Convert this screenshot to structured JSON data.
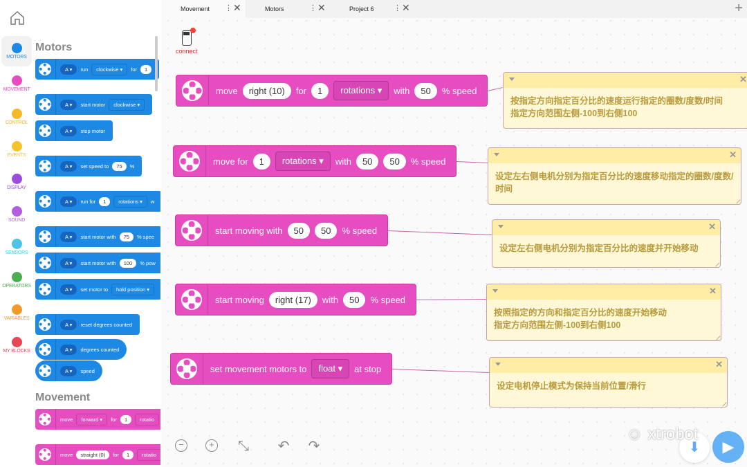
{
  "sidebar": {
    "categories": [
      {
        "label": "MOTORS",
        "color": "#1e88e5",
        "selected": true
      },
      {
        "label": "MOVEMENT",
        "color": "#e64dc1"
      },
      {
        "label": "CONTROL",
        "color": "#f5b72c"
      },
      {
        "label": "EVENTS",
        "color": "#f5c32c"
      },
      {
        "label": "DISPLAY",
        "color": "#9c4ddf"
      },
      {
        "label": "SOUND",
        "color": "#b45ee0"
      },
      {
        "label": "SENSORS",
        "color": "#4fc3e8"
      },
      {
        "label": "OPERATORS",
        "color": "#4caf50"
      },
      {
        "label": "VARIABLES",
        "color": "#f39a2b"
      },
      {
        "label": "MY BLOCKS",
        "color": "#e84855"
      }
    ]
  },
  "palette": {
    "motors_heading": "Motors",
    "movement_heading": "Movement",
    "blocks": [
      {
        "kind": "motor",
        "parts": [
          [
            "dd",
            "A ▾"
          ],
          [
            "t",
            "run"
          ],
          [
            "ddr",
            "clockwise ▾"
          ],
          [
            "t",
            "for"
          ],
          [
            "fld",
            "1"
          ]
        ]
      },
      {
        "kind": "motor",
        "parts": [
          [
            "dd",
            "A ▾"
          ],
          [
            "t",
            "start motor"
          ],
          [
            "ddr",
            "clockwise ▾"
          ]
        ]
      },
      {
        "kind": "motor",
        "parts": [
          [
            "dd",
            "A ▾"
          ],
          [
            "t",
            "stop motor"
          ]
        ]
      },
      {
        "kind": "motor",
        "parts": [
          [
            "dd",
            "A ▾"
          ],
          [
            "t",
            "set speed to"
          ],
          [
            "fld",
            "75"
          ],
          [
            "t",
            "%"
          ]
        ]
      },
      {
        "kind": "motor",
        "parts": [
          [
            "dd",
            "A ▾"
          ],
          [
            "t",
            "run for"
          ],
          [
            "fld",
            "1"
          ],
          [
            "ddr",
            "rotations ▾"
          ],
          [
            "t",
            "w"
          ]
        ]
      },
      {
        "kind": "motor",
        "parts": [
          [
            "dd",
            "A ▾"
          ],
          [
            "t",
            "start motor with"
          ],
          [
            "fld",
            "75"
          ],
          [
            "t",
            "% spee"
          ]
        ]
      },
      {
        "kind": "motor",
        "parts": [
          [
            "dd",
            "A ▾"
          ],
          [
            "t",
            "start motor with"
          ],
          [
            "fld",
            "100"
          ],
          [
            "t",
            "% pow"
          ]
        ]
      },
      {
        "kind": "motor",
        "parts": [
          [
            "dd",
            "A ▾"
          ],
          [
            "t",
            "set motor to"
          ],
          [
            "ddr",
            "hold position ▾"
          ]
        ]
      },
      {
        "kind": "motor",
        "parts": [
          [
            "dd",
            "A ▾"
          ],
          [
            "t",
            "reset degrees counted"
          ]
        ]
      },
      {
        "kind": "reporter",
        "parts": [
          [
            "dd",
            "A ▾"
          ],
          [
            "t",
            "degrees counted"
          ]
        ]
      },
      {
        "kind": "reporter",
        "parts": [
          [
            "dd",
            "A ▾"
          ],
          [
            "t",
            "speed"
          ]
        ]
      },
      {
        "kind": "movement",
        "parts": [
          [
            "t",
            "move"
          ],
          [
            "ddr",
            "forward ▾"
          ],
          [
            "t",
            "for"
          ],
          [
            "fld",
            "1"
          ],
          [
            "ddr",
            "rotatio"
          ]
        ]
      },
      {
        "kind": "movement",
        "parts": [
          [
            "t",
            "move"
          ],
          [
            "fld",
            "straight (0)"
          ],
          [
            "t",
            "for"
          ],
          [
            "fld",
            "1"
          ],
          [
            "ddr",
            "rotatio"
          ]
        ]
      }
    ]
  },
  "tabs": [
    {
      "label": "Movement",
      "selected": true
    },
    {
      "label": "Motors"
    },
    {
      "label": "Project 6"
    }
  ],
  "tabs_add": "+",
  "connect_label": "connect",
  "canvas_blocks": [
    {
      "parts": [
        [
          "t",
          "move"
        ],
        [
          "fld",
          "right (10)"
        ],
        [
          "t",
          "for"
        ],
        [
          "fld",
          "1"
        ],
        [
          "ddr",
          "rotations ▾"
        ],
        [
          "t",
          "with"
        ],
        [
          "fld",
          "50"
        ],
        [
          "t",
          "% speed"
        ]
      ],
      "comment": "按指定方向指定百分比的速度运行指定的圈数/度数/时间\n指定方向范围左侧-100到右侧100"
    },
    {
      "parts": [
        [
          "t",
          "move for"
        ],
        [
          "fld",
          "1"
        ],
        [
          "ddr",
          "rotations ▾"
        ],
        [
          "t",
          "with"
        ],
        [
          "fld",
          "50"
        ],
        [
          "fld",
          "50"
        ],
        [
          "t",
          "% speed"
        ]
      ],
      "comment": "设定左右侧电机分别为指定百分比的速度移动指定的圈数/度数/时间"
    },
    {
      "parts": [
        [
          "t",
          "start moving with"
        ],
        [
          "fld",
          "50"
        ],
        [
          "fld",
          "50"
        ],
        [
          "t",
          "% speed"
        ]
      ],
      "comment": "设定左右侧电机分别为指定百分比的速度并开始移动"
    },
    {
      "parts": [
        [
          "t",
          "start moving"
        ],
        [
          "fld",
          "right (17)"
        ],
        [
          "t",
          "with"
        ],
        [
          "fld",
          "50"
        ],
        [
          "t",
          "% speed"
        ]
      ],
      "comment": "按照指定的方向和指定百分比的速度开始移动\n指定方向范围左侧-100到右侧100"
    },
    {
      "parts": [
        [
          "t",
          "set movement motors to"
        ],
        [
          "ddr",
          "float ▾"
        ],
        [
          "t",
          "at stop"
        ]
      ],
      "comment": "设定电机停止模式为保持当前位置/滑行"
    }
  ],
  "toolbar": {
    "zoom_out": "−",
    "zoom_in": "+",
    "fit": "⤡",
    "undo": "↶",
    "redo": "↷"
  },
  "watermark": "xtrobot",
  "colors": {
    "motors": "#1e88e5",
    "movement": "#e64dc1",
    "comment": "#fff8d6",
    "run": "#64b1f5"
  }
}
